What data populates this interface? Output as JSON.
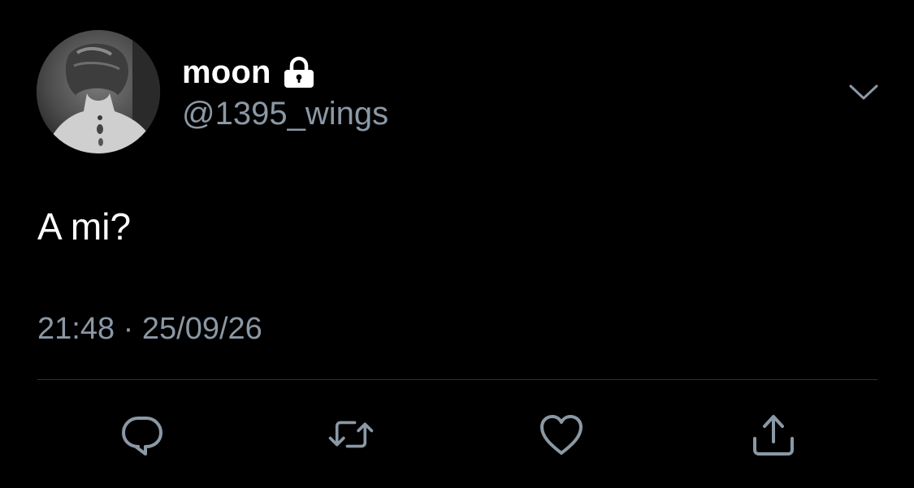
{
  "tweet": {
    "display_name": "moon",
    "handle": "@1395_wings",
    "text": "A mi?",
    "timestamp": "21:48 · 25/09/26",
    "protected": true
  },
  "icons": {
    "avatar": "avatar-image",
    "lock": "lock-icon",
    "more": "chevron-down-icon",
    "reply": "reply-icon",
    "retweet": "retweet-icon",
    "like": "heart-icon",
    "share": "share-icon"
  },
  "colors": {
    "background": "#000000",
    "primary_text": "#ffffff",
    "secondary_text": "#8b98a5",
    "divider": "#2f3336",
    "icon": "#8b98a5"
  }
}
